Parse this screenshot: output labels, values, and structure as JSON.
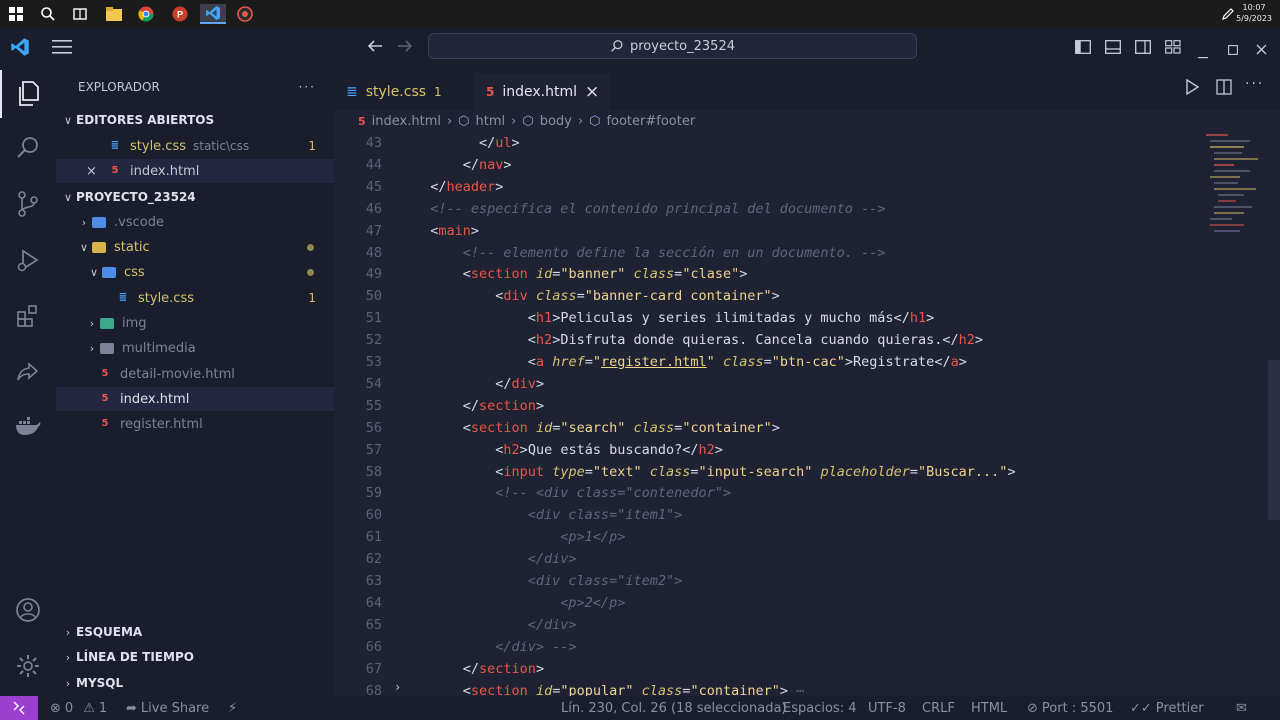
{
  "taskbar": {
    "clock_time": "10:07",
    "clock_date": "5/9/2023"
  },
  "titlebar": {
    "search_text": "proyecto_23524"
  },
  "sidebar": {
    "header": "EXPLORADOR",
    "open_editors_title": "EDITORES ABIERTOS",
    "open_editors": [
      {
        "name": "style.css",
        "path": "static\\css",
        "badge": "1"
      },
      {
        "name": "index.html"
      }
    ],
    "project_title": "PROYECTO_23524",
    "tree": [
      {
        "name": ".vscode"
      },
      {
        "name": "static"
      },
      {
        "name": "css"
      },
      {
        "name": "style.css",
        "badge": "1"
      },
      {
        "name": "img"
      },
      {
        "name": "multimedia"
      },
      {
        "name": "detail-movie.html"
      },
      {
        "name": "index.html"
      },
      {
        "name": "register.html"
      }
    ],
    "bottom_sections": [
      "ESQUEMA",
      "LÍNEA DE TIEMPO",
      "MYSQL"
    ]
  },
  "tabs": [
    {
      "label": "style.css",
      "badge": "1"
    },
    {
      "label": "index.html",
      "close": "×"
    }
  ],
  "breadcrumb": [
    "index.html",
    "html",
    "body",
    "footer#footer"
  ],
  "editor": {
    "lines": [
      {
        "n": "43",
        "segs": [
          [
            "br",
            "        </"
          ],
          [
            "tag",
            "ul"
          ],
          [
            "br",
            ">"
          ]
        ]
      },
      {
        "n": "44",
        "segs": [
          [
            "br",
            "      </"
          ],
          [
            "tag",
            "nav"
          ],
          [
            "br",
            ">"
          ]
        ]
      },
      {
        "n": "45",
        "segs": [
          [
            "br",
            "  </"
          ],
          [
            "tag",
            "header"
          ],
          [
            "br",
            ">"
          ]
        ]
      },
      {
        "n": "46",
        "segs": [
          [
            "com",
            "  <!-- especifica el contenido principal del documento -->"
          ]
        ]
      },
      {
        "n": "47",
        "segs": [
          [
            "br",
            "  <"
          ],
          [
            "tag",
            "main"
          ],
          [
            "br",
            ">"
          ]
        ]
      },
      {
        "n": "48",
        "segs": [
          [
            "com",
            "      <!-- elemento define la sección en un documento. -->"
          ]
        ]
      },
      {
        "n": "49",
        "segs": [
          [
            "br",
            "      <"
          ],
          [
            "tag",
            "section"
          ],
          [
            "txt",
            " "
          ],
          [
            "attr",
            "id"
          ],
          [
            "br",
            "="
          ],
          [
            "str",
            "\"banner\""
          ],
          [
            "txt",
            " "
          ],
          [
            "attr",
            "class"
          ],
          [
            "br",
            "="
          ],
          [
            "str",
            "\"clase\""
          ],
          [
            "br",
            ">"
          ]
        ]
      },
      {
        "n": "50",
        "segs": [
          [
            "br",
            "          <"
          ],
          [
            "tag",
            "div"
          ],
          [
            "txt",
            " "
          ],
          [
            "attr",
            "class"
          ],
          [
            "br",
            "="
          ],
          [
            "str",
            "\"banner-card container\""
          ],
          [
            "br",
            ">"
          ]
        ]
      },
      {
        "n": "51",
        "segs": [
          [
            "br",
            "              <"
          ],
          [
            "tag",
            "h1"
          ],
          [
            "br",
            ">"
          ],
          [
            "txt",
            "Peliculas y series ilimitadas y mucho más"
          ],
          [
            "br",
            "</"
          ],
          [
            "tag",
            "h1"
          ],
          [
            "br",
            ">"
          ]
        ]
      },
      {
        "n": "52",
        "segs": [
          [
            "br",
            "              <"
          ],
          [
            "tag",
            "h2"
          ],
          [
            "br",
            ">"
          ],
          [
            "txt",
            "Disfruta donde quieras. Cancela cuando quieras."
          ],
          [
            "br",
            "</"
          ],
          [
            "tag",
            "h2"
          ],
          [
            "br",
            ">"
          ]
        ]
      },
      {
        "n": "53",
        "segs": [
          [
            "br",
            "              <"
          ],
          [
            "tag",
            "a"
          ],
          [
            "txt",
            " "
          ],
          [
            "attr",
            "href"
          ],
          [
            "br",
            "="
          ],
          [
            "str",
            "\""
          ],
          [
            "strlink",
            "register.html"
          ],
          [
            "str",
            "\""
          ],
          [
            "txt",
            " "
          ],
          [
            "attr",
            "class"
          ],
          [
            "br",
            "="
          ],
          [
            "str",
            "\"btn-cac\""
          ],
          [
            "br",
            ">"
          ],
          [
            "txt",
            "Registrate"
          ],
          [
            "br",
            "</"
          ],
          [
            "tag",
            "a"
          ],
          [
            "br",
            ">"
          ]
        ]
      },
      {
        "n": "54",
        "segs": [
          [
            "br",
            "          </"
          ],
          [
            "tag",
            "div"
          ],
          [
            "br",
            ">"
          ]
        ]
      },
      {
        "n": "55",
        "segs": [
          [
            "br",
            "      </"
          ],
          [
            "tag",
            "section"
          ],
          [
            "br",
            ">"
          ]
        ]
      },
      {
        "n": "56",
        "segs": [
          [
            "br",
            "      <"
          ],
          [
            "tag",
            "section"
          ],
          [
            "txt",
            " "
          ],
          [
            "attr",
            "id"
          ],
          [
            "br",
            "="
          ],
          [
            "str",
            "\"search\""
          ],
          [
            "txt",
            " "
          ],
          [
            "attr",
            "class"
          ],
          [
            "br",
            "="
          ],
          [
            "str",
            "\"container\""
          ],
          [
            "br",
            ">"
          ]
        ]
      },
      {
        "n": "57",
        "segs": [
          [
            "br",
            "          <"
          ],
          [
            "tag",
            "h2"
          ],
          [
            "br",
            ">"
          ],
          [
            "txt",
            "Que estás buscando?"
          ],
          [
            "br",
            "</"
          ],
          [
            "tag",
            "h2"
          ],
          [
            "br",
            ">"
          ]
        ]
      },
      {
        "n": "58",
        "segs": [
          [
            "br",
            "          <"
          ],
          [
            "tag",
            "input"
          ],
          [
            "txt",
            " "
          ],
          [
            "attr",
            "type"
          ],
          [
            "br",
            "="
          ],
          [
            "str",
            "\"text\""
          ],
          [
            "txt",
            " "
          ],
          [
            "attr",
            "class"
          ],
          [
            "br",
            "="
          ],
          [
            "str",
            "\"input-search\""
          ],
          [
            "txt",
            " "
          ],
          [
            "attr",
            "placeholder"
          ],
          [
            "br",
            "="
          ],
          [
            "str",
            "\"Buscar...\""
          ],
          [
            "br",
            ">"
          ]
        ]
      },
      {
        "n": "59",
        "segs": [
          [
            "com",
            "          <!-- <div class=\"contenedor\">"
          ]
        ]
      },
      {
        "n": "60",
        "segs": [
          [
            "com",
            "              <div class=\"item1\">"
          ]
        ]
      },
      {
        "n": "61",
        "segs": [
          [
            "com",
            "                  <p>1</p>"
          ]
        ]
      },
      {
        "n": "62",
        "segs": [
          [
            "com",
            "              </div>"
          ]
        ]
      },
      {
        "n": "63",
        "segs": [
          [
            "com",
            "              <div class=\"item2\">"
          ]
        ]
      },
      {
        "n": "64",
        "segs": [
          [
            "com",
            "                  <p>2</p>"
          ]
        ]
      },
      {
        "n": "65",
        "segs": [
          [
            "com",
            "              </div>"
          ]
        ]
      },
      {
        "n": "66",
        "segs": [
          [
            "com",
            "          </div> -->"
          ]
        ]
      },
      {
        "n": "67",
        "segs": [
          [
            "br",
            "      </"
          ],
          [
            "tag",
            "section"
          ],
          [
            "br",
            ">"
          ]
        ]
      },
      {
        "n": "68",
        "segs": [
          [
            "br",
            "      <"
          ],
          [
            "tag",
            "section"
          ],
          [
            "txt",
            " "
          ],
          [
            "attr",
            "id"
          ],
          [
            "br",
            "="
          ],
          [
            "str",
            "\"popular\""
          ],
          [
            "txt",
            " "
          ],
          [
            "attr",
            "class"
          ],
          [
            "br",
            "="
          ],
          [
            "str",
            "\"container\""
          ],
          [
            "br",
            ">"
          ],
          [
            "com",
            " ⋯"
          ]
        ]
      }
    ]
  },
  "statusbar": {
    "errors": "0",
    "warnings": "1",
    "live_share": "Live Share",
    "position": "Lín. 230, Col. 26 (18 seleccionada)",
    "spaces": "Espacios: 4",
    "encoding": "UTF-8",
    "eol": "CRLF",
    "language": "HTML",
    "port": "Port : 5501",
    "prettier": "Prettier"
  },
  "colors": {
    "accent_remote": "#9b3fd1",
    "tag": "#e8574a",
    "attr": "#d7c36a",
    "string": "#f1d38b",
    "comment": "#5e667f"
  }
}
